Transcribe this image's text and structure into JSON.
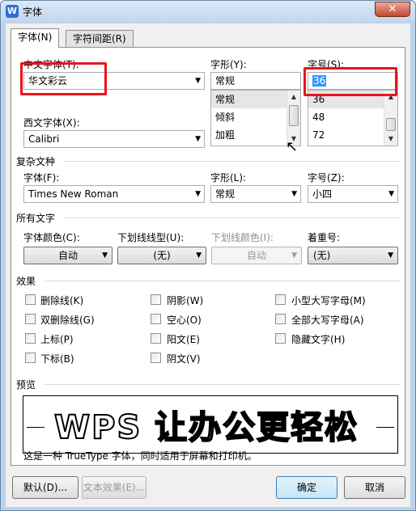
{
  "window": {
    "title": "字体",
    "close": "✕"
  },
  "tabs": [
    {
      "label": "字体(N)"
    },
    {
      "label": "字符间距(R)"
    }
  ],
  "chinese_font": {
    "label": "中文字体(T):",
    "value": "华文彩云"
  },
  "western_font": {
    "label": "西文字体(X):",
    "value": "Calibri"
  },
  "style": {
    "label": "字形(Y):",
    "value": "常规",
    "options": [
      "常规",
      "倾斜",
      "加粗"
    ]
  },
  "size": {
    "label": "字号(S):",
    "value": "36",
    "options": [
      "36",
      "48",
      "72"
    ]
  },
  "complex": {
    "section": "复杂文种",
    "font_label": "字体(F):",
    "font_value": "Times New Roman",
    "style_label": "字形(L):",
    "style_value": "常规",
    "size_label": "字号(Z):",
    "size_value": "小四"
  },
  "all_text": {
    "section": "所有文字",
    "color_label": "字体颜色(C):",
    "color_value": "自动",
    "underline_label": "下划线线型(U):",
    "underline_value": "(无)",
    "underline_color_label": "下划线颜色(I):",
    "underline_color_value": "自动",
    "emphasis_label": "着重号:",
    "emphasis_value": "(无)"
  },
  "effects": {
    "section": "效果",
    "items": [
      "删除线(K)",
      "阴影(W)",
      "小型大写字母(M)",
      "双删除线(G)",
      "空心(O)",
      "全部大写字母(A)",
      "上标(P)",
      "阳文(E)",
      "隐藏文字(H)",
      "下标(B)",
      "阴文(V)"
    ]
  },
  "preview": {
    "section": "预览",
    "text": "WPS 让办公更轻松",
    "note": "这是一种 TrueType 字体，同时适用于屏幕和打印机。"
  },
  "buttons": {
    "default": "默认(D)...",
    "text_effect": "文本效果(E)...",
    "ok": "确定",
    "cancel": "取消"
  },
  "annotation_color": "#e8141c"
}
